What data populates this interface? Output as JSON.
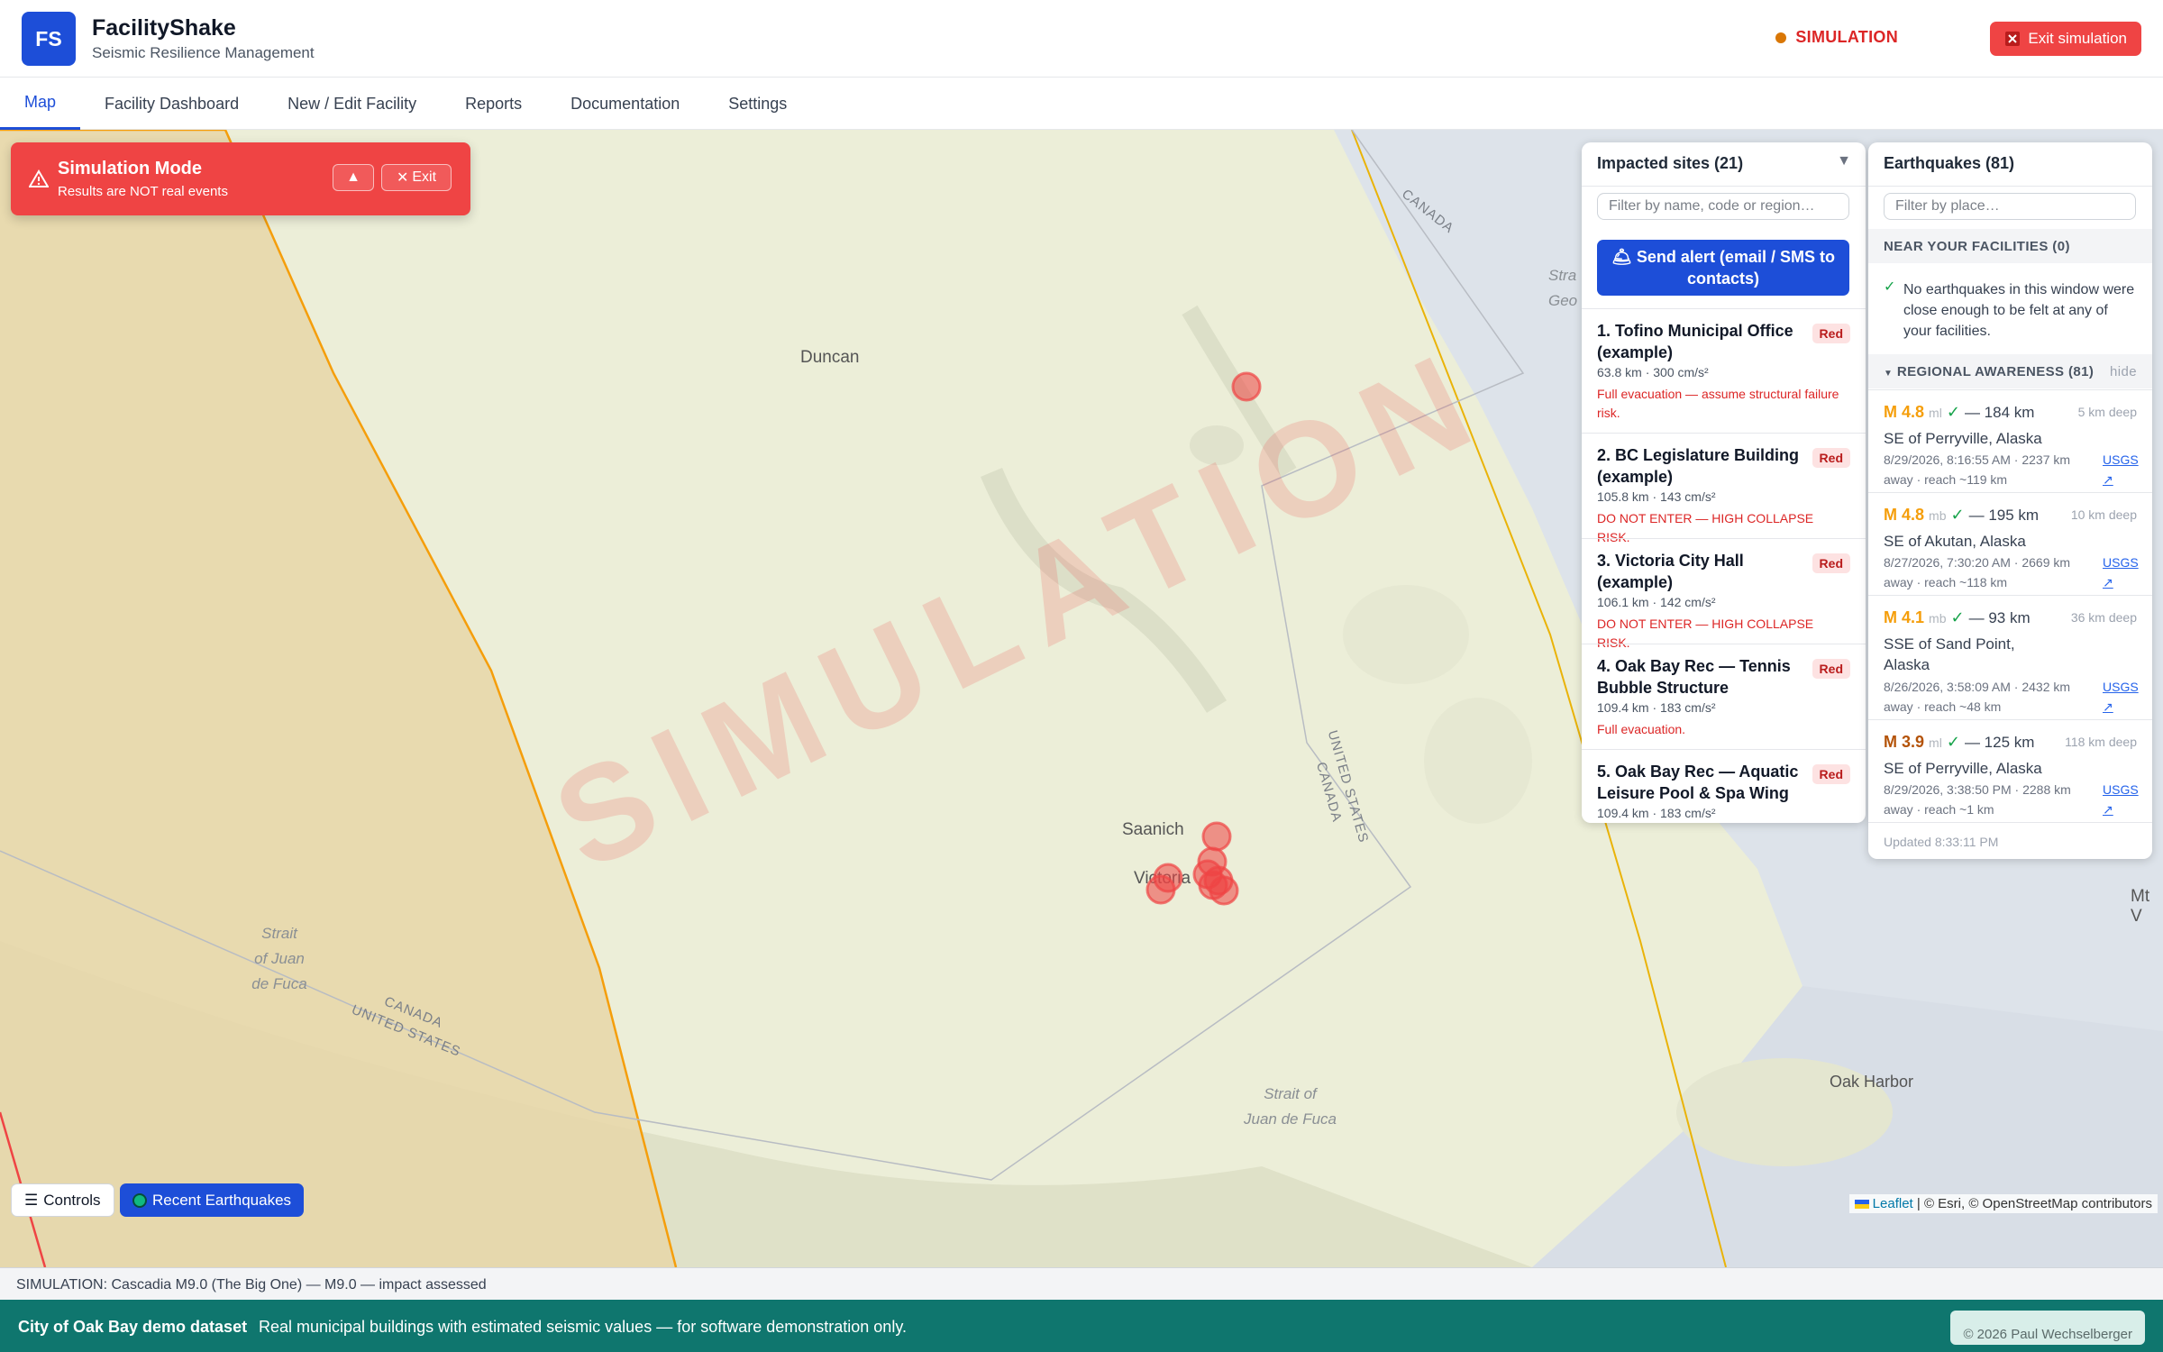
{
  "header": {
    "logo": "FS",
    "title": "FacilityShake",
    "subtitle": "Seismic Resilience Management",
    "sim_indicator": "SIMULATION",
    "exit_button": "Exit simulation"
  },
  "tabs": [
    {
      "label": "Map",
      "active": true
    },
    {
      "label": "Facility Dashboard"
    },
    {
      "label": "New / Edit Facility"
    },
    {
      "label": "Reports"
    },
    {
      "label": "Documentation"
    },
    {
      "label": "Settings"
    }
  ],
  "sim_banner": {
    "title": "Simulation Mode",
    "subtitle": "Results are NOT real events",
    "collapse_label": "▲",
    "exit_label": "Exit"
  },
  "map": {
    "watermark": "SIMULATION",
    "labels": {
      "duncan": "Duncan",
      "saanich": "Saanich",
      "victoria": "Victoria",
      "oak_harbor": "Oak Harbor",
      "mt": "Mt V",
      "strait_west": "Strait\nof Juan\nde Fuca",
      "strait_east": "Strait of\nJuan de Fuca",
      "strait_geo": "Stra\nGeo",
      "canada_top": "CANADA",
      "canada_us_left": "CANADA\nUNITED STATES",
      "us_canada_mid": "UNITED STATES\nCANADA"
    },
    "controls_button": "Controls",
    "recent_button": "Recent Earthquakes",
    "attribution_leaflet": "Leaflet",
    "attribution_rest": "| © Esri, © OpenStreetMap contributors",
    "zoom_in": "+",
    "zoom_out": "−",
    "colors": {
      "ocean": "#a9c4d4",
      "land": "#eceed8",
      "zone": "#e8d6a8",
      "danger": "#ef4444"
    }
  },
  "impacted": {
    "title": "Impacted sites (21)",
    "toggle": "▼",
    "filter_placeholder": "Filter by name, code or region…",
    "send_alert": "Send alert (email / SMS to contacts)",
    "sites": [
      {
        "name": "1. Tofino Municipal Office (example)",
        "badge": "Red",
        "meta": "63.8 km · 300 cm/s²",
        "action": "Full evacuation — assume structural failure risk."
      },
      {
        "name": "2. BC Legislature Building (example)",
        "badge": "Red",
        "meta": "105.8 km · 143 cm/s²",
        "action": "DO NOT ENTER — HIGH COLLAPSE RISK."
      },
      {
        "name": "3. Victoria City Hall (example)",
        "badge": "Red",
        "meta": "106.1 km · 142 cm/s²",
        "action": "DO NOT ENTER — HIGH COLLAPSE RISK."
      },
      {
        "name": "4. Oak Bay Rec — Tennis Bubble Structure",
        "badge": "Red",
        "meta": "109.4 km · 183 cm/s²",
        "action": "Full evacuation."
      },
      {
        "name": "5. Oak Bay Rec — Aquatic Leisure Pool & Spa Wing",
        "badge": "Red",
        "meta": "109.4 km · 183 cm/s²",
        "action": ""
      }
    ]
  },
  "earthquakes": {
    "title": "Earthquakes (81)",
    "filter_placeholder": "Filter by place…",
    "near_title": "NEAR YOUR FACILITIES (0)",
    "near_message": "No earthquakes in this window were close enough to be felt at any of your facilities.",
    "regional_title": "REGIONAL AWARENESS (81)",
    "regional_hide": "hide",
    "items": [
      {
        "mag": "M 4.8",
        "type": "ml",
        "dist": "— 184 km",
        "depth": "5 km deep",
        "place": "SE of Perryville, Alaska",
        "time": "8/29/2026, 8:16:55 AM · 2237 km away · reach ~119 km",
        "link": "USGS ↗",
        "color": "#f59e0b"
      },
      {
        "mag": "M 4.8",
        "type": "mb",
        "dist": "— 195 km",
        "depth": "10 km deep",
        "place": "SE of Akutan, Alaska",
        "time": "8/27/2026, 7:30:20 AM · 2669 km away · reach ~118 km",
        "link": "USGS ↗",
        "color": "#f59e0b"
      },
      {
        "mag": "M 4.1",
        "type": "mb",
        "dist": "— 93 km",
        "depth": "36 km deep",
        "place": "SSE of Sand Point, Alaska",
        "time": "8/26/2026, 3:58:09 AM · 2432 km away · reach ~48 km",
        "link": "USGS ↗",
        "color": "#f59e0b"
      },
      {
        "mag": "M 3.9",
        "type": "ml",
        "dist": "— 125 km",
        "depth": "118 km deep",
        "place": "SE of Perryville, Alaska",
        "time": "8/29/2026, 3:38:50 PM · 2288 km away · reach ~1 km",
        "link": "USGS ↗",
        "color": "#b45309"
      }
    ],
    "updated": "Updated 8:33:11 PM"
  },
  "status_bar": "SIMULATION: Cascadia M9.0 (The Big One) — M9.0 — impact assessed",
  "footer": {
    "title": "City of Oak Bay demo dataset",
    "description": "Real municipal buildings with estimated seismic values — for software demonstration only.",
    "copyright": "© 2026 Paul Wechselberger"
  }
}
